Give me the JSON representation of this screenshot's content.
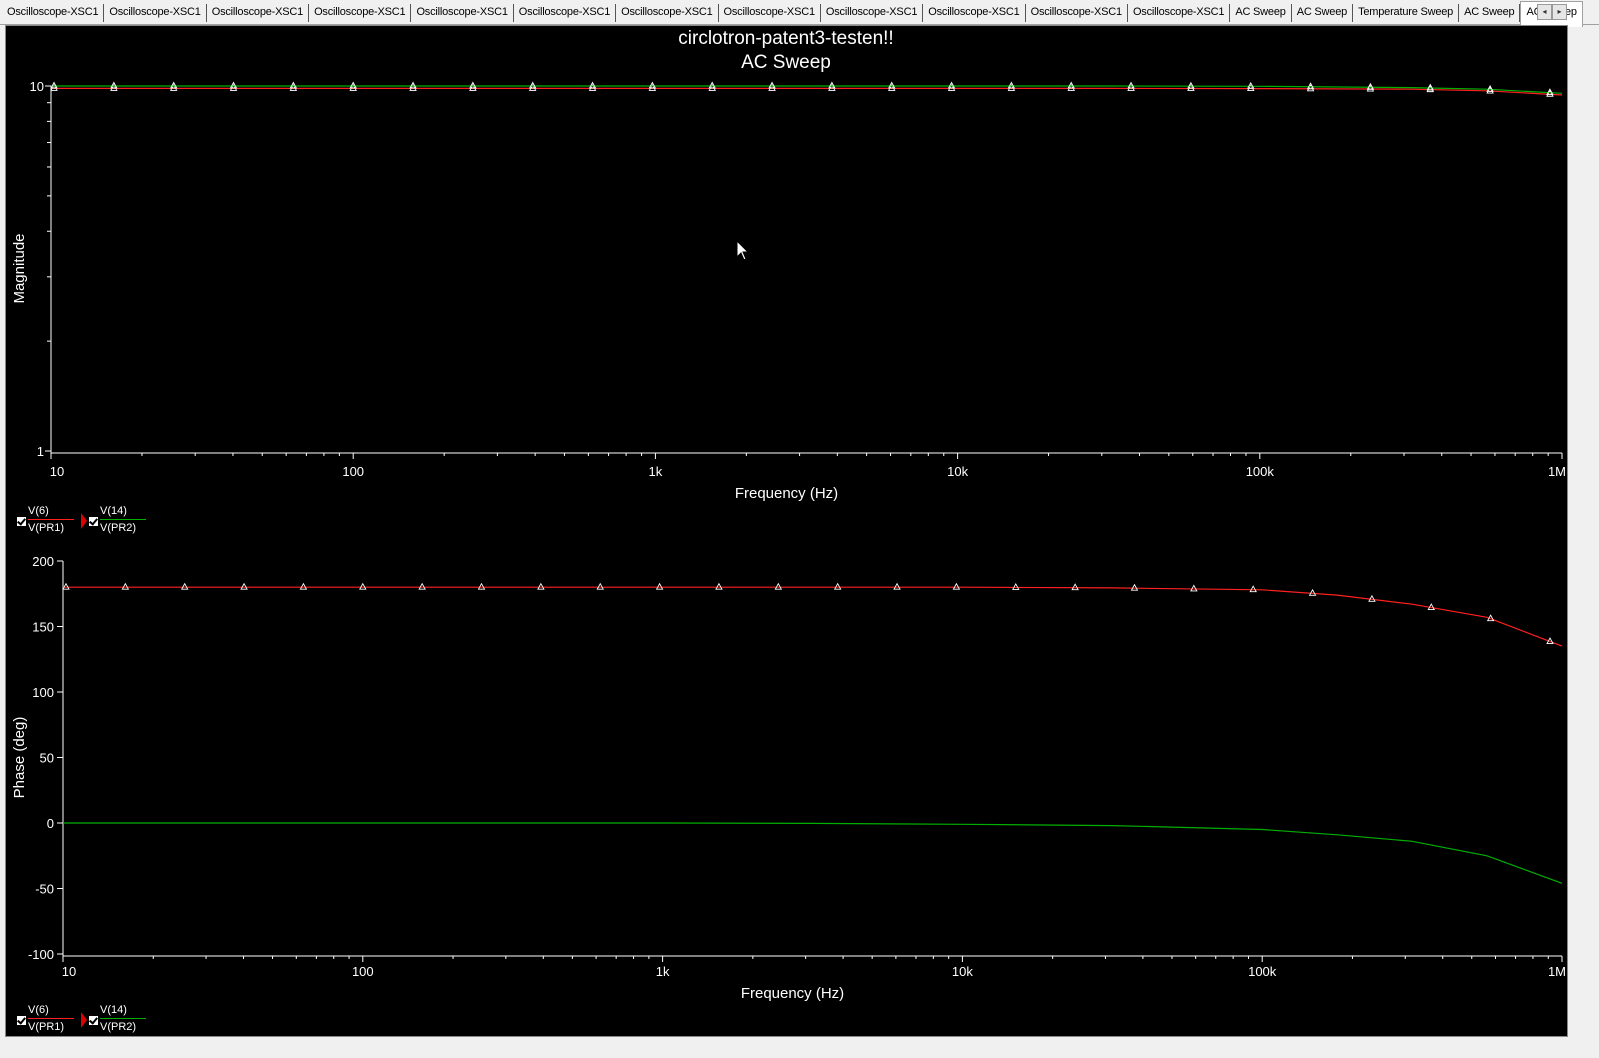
{
  "tabs": [
    {
      "label": "Oscilloscope-XSC1"
    },
    {
      "label": "Oscilloscope-XSC1"
    },
    {
      "label": "Oscilloscope-XSC1"
    },
    {
      "label": "Oscilloscope-XSC1"
    },
    {
      "label": "Oscilloscope-XSC1"
    },
    {
      "label": "Oscilloscope-XSC1"
    },
    {
      "label": "Oscilloscope-XSC1"
    },
    {
      "label": "Oscilloscope-XSC1"
    },
    {
      "label": "Oscilloscope-XSC1"
    },
    {
      "label": "Oscilloscope-XSC1"
    },
    {
      "label": "Oscilloscope-XSC1"
    },
    {
      "label": "Oscilloscope-XSC1"
    },
    {
      "label": "AC Sweep"
    },
    {
      "label": "AC Sweep"
    },
    {
      "label": "Temperature Sweep"
    },
    {
      "label": "AC Sweep"
    },
    {
      "label": "AC Sweep",
      "active": true
    }
  ],
  "tab_scroll": {
    "left": "◂",
    "right": "▸"
  },
  "legend_top": [
    {
      "line1": "V(6)",
      "line2": "V(PR1)",
      "color": "#ff2020",
      "checked": true
    },
    {
      "line1": "V(14)",
      "line2": "V(PR2)",
      "color": "#00b000",
      "checked": true
    }
  ],
  "legend_bottom": [
    {
      "line1": "V(6)",
      "line2": "V(PR1)",
      "color": "#ff2020",
      "checked": true
    },
    {
      "line1": "V(14)",
      "line2": "V(PR2)",
      "color": "#00b000",
      "checked": true
    }
  ],
  "chart_data": [
    {
      "type": "line",
      "title": "circlotron-patent3-testen!!",
      "subtitle": "AC Sweep",
      "xlabel": "Frequency (Hz)",
      "ylabel": "Magnitude",
      "xscale": "log",
      "yscale": "log",
      "xlim": [
        10,
        1000000
      ],
      "ylim": [
        1,
        10
      ],
      "xticks": [
        10,
        100,
        1000,
        10000,
        100000,
        1000000
      ],
      "xtick_labels": [
        "10",
        "100",
        "1k",
        "10k",
        "100k",
        "1M"
      ],
      "yticks": [
        1,
        10
      ],
      "ytick_labels": [
        "1",
        "10"
      ],
      "grid": false,
      "x": [
        10,
        31.6,
        100,
        316,
        1000,
        3162,
        10000,
        31623,
        100000,
        316228,
        562341,
        1000000
      ],
      "series": [
        {
          "name": "V(6)",
          "color": "#ff2020",
          "marker": "triangle",
          "values": [
            9.85,
            9.85,
            9.85,
            9.85,
            9.85,
            9.85,
            9.85,
            9.85,
            9.84,
            9.8,
            9.7,
            9.45
          ]
        },
        {
          "name": "V(14)",
          "color": "#00b000",
          "marker": "triangle",
          "values": [
            10.0,
            10.0,
            10.0,
            10.0,
            10.0,
            10.0,
            10.0,
            10.0,
            9.98,
            9.9,
            9.8,
            9.55
          ]
        }
      ]
    },
    {
      "type": "line",
      "xlabel": "Frequency (Hz)",
      "ylabel": "Phase (deg)",
      "xscale": "log",
      "xlim": [
        10,
        1000000
      ],
      "ylim": [
        -100,
        200
      ],
      "xticks": [
        10,
        100,
        1000,
        10000,
        100000,
        1000000
      ],
      "xtick_labels": [
        "10",
        "100",
        "1k",
        "10k",
        "100k",
        "1M"
      ],
      "yticks": [
        -100,
        -50,
        0,
        50,
        100,
        150,
        200
      ],
      "ytick_labels": [
        "-100",
        "-50",
        "0",
        "50",
        "100",
        "150",
        "200"
      ],
      "grid": false,
      "x": [
        10,
        31.6,
        100,
        316,
        1000,
        3162,
        10000,
        31623,
        100000,
        177828,
        316228,
        562341,
        1000000
      ],
      "series": [
        {
          "name": "V(6)",
          "color": "#ff2020",
          "marker": "triangle",
          "values": [
            180,
            180,
            180,
            180,
            180,
            180,
            180,
            179.5,
            178,
            174,
            167,
            157,
            135
          ]
        },
        {
          "name": "V(14)",
          "color": "#00b000",
          "values": [
            0,
            0,
            0,
            0,
            0,
            -0.3,
            -1,
            -2,
            -5,
            -9,
            -14,
            -25,
            -46
          ]
        }
      ]
    }
  ]
}
